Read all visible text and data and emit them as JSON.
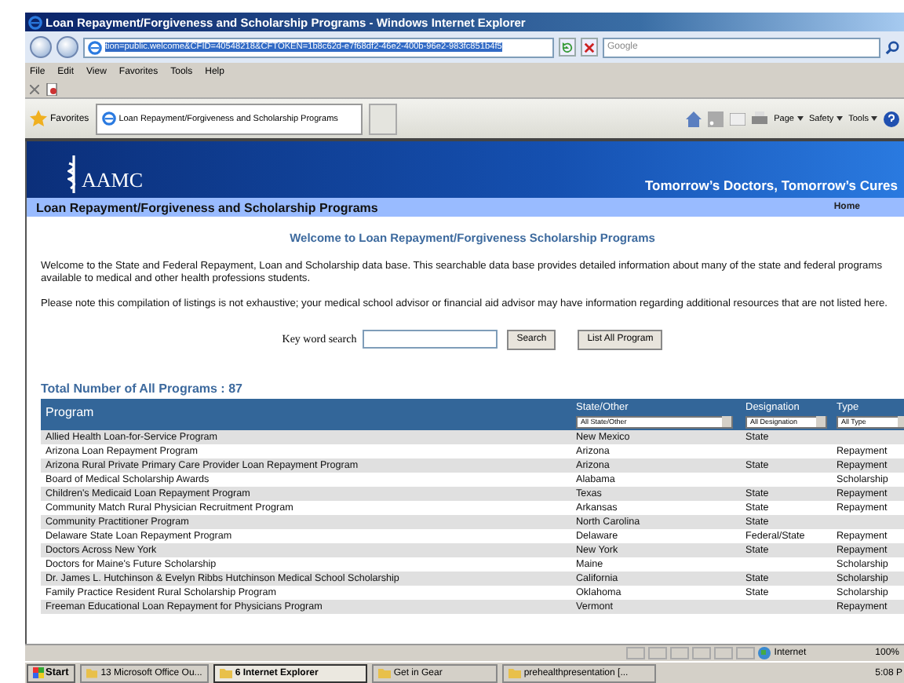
{
  "window": {
    "title": "Loan Repayment/Forgiveness and Scholarship Programs - Windows Internet Explorer"
  },
  "address_bar": {
    "url": "tion=public.welcome&CFID=40548218&CFTOKEN=1b8c62d-e7f68df2-46e2-400b-96e2-983fc851b4f5",
    "search_placeholder": "Google"
  },
  "menu": [
    "File",
    "Edit",
    "View",
    "Favorites",
    "Tools",
    "Help"
  ],
  "favorites_bar": {
    "label": "Favorites",
    "tab": "Loan Repayment/Forgiveness and Scholarship Programs",
    "commands": [
      "Page",
      "Safety",
      "Tools"
    ]
  },
  "banner": {
    "logo": "AAMC",
    "tagline": "Tomorrow’s Doctors, Tomorrow’s Cures"
  },
  "subheader": {
    "title": "Loan Repayment/Forgiveness and Scholarship Programs",
    "link": "Home"
  },
  "heading": "Welcome to Loan Repayment/Forgiveness Scholarship Programs",
  "paragraphs": [
    "Welcome to the State and Federal Repayment, Loan and Scholarship data base. This searchable data base provides detailed information about many of the state and federal programs available to medical and other health professions students.",
    "Please note this compilation of listings is not exhaustive; your medical school advisor or financial aid advisor may have information regarding additional resources that are not listed here."
  ],
  "search": {
    "label": "Key word search",
    "button": "Search",
    "list_button": "List All Program"
  },
  "total": "Total Number of All Programs : 87",
  "table": {
    "columns": [
      {
        "label": "Program"
      },
      {
        "label": "State/Other",
        "filter": "All State/Other"
      },
      {
        "label": "Designation",
        "filter": "All Designation"
      },
      {
        "label": "Type",
        "filter": "All Type"
      }
    ],
    "rows": [
      [
        "Allied Health Loan-for-Service Program",
        "New Mexico",
        "State",
        ""
      ],
      [
        "Arizona Loan Repayment Program",
        "Arizona",
        "",
        "Repayment"
      ],
      [
        "Arizona Rural Private Primary Care Provider Loan Repayment Program",
        "Arizona",
        "State",
        "Repayment"
      ],
      [
        "Board of Medical Scholarship Awards",
        "Alabama",
        "",
        "Scholarship"
      ],
      [
        "Children's Medicaid Loan Repayment Program",
        "Texas",
        "State",
        "Repayment"
      ],
      [
        "Community Match Rural Physician Recruitment Program",
        "Arkansas",
        "State",
        "Repayment"
      ],
      [
        "Community Practitioner Program",
        "North Carolina",
        "State",
        ""
      ],
      [
        "Delaware State Loan Repayment Program",
        "Delaware",
        "Federal/State",
        "Repayment"
      ],
      [
        "Doctors Across New York",
        "New York",
        "State",
        "Repayment"
      ],
      [
        "Doctors for Maine's Future Scholarship",
        "Maine",
        "",
        "Scholarship"
      ],
      [
        "Dr. James L. Hutchinson & Evelyn Ribbs Hutchinson Medical School Scholarship",
        "California",
        "State",
        "Scholarship"
      ],
      [
        "Family Practice Resident Rural Scholarship Program",
        "Oklahoma",
        "State",
        "Scholarship"
      ],
      [
        "Freeman Educational Loan Repayment for Physicians Program",
        "Vermont",
        "",
        "Repayment"
      ]
    ]
  },
  "status_bar": {
    "zone": "Internet",
    "zoom": "100%"
  },
  "taskbar": {
    "start": "Start",
    "items": [
      {
        "label": "13 Microsoft Office Ou...",
        "selected": false
      },
      {
        "label": "6 Internet Explorer",
        "selected": true
      },
      {
        "label": "Get in Gear",
        "selected": false
      },
      {
        "label": "prehealthpresentation [...",
        "selected": false
      }
    ],
    "clock": "5:08 P"
  }
}
